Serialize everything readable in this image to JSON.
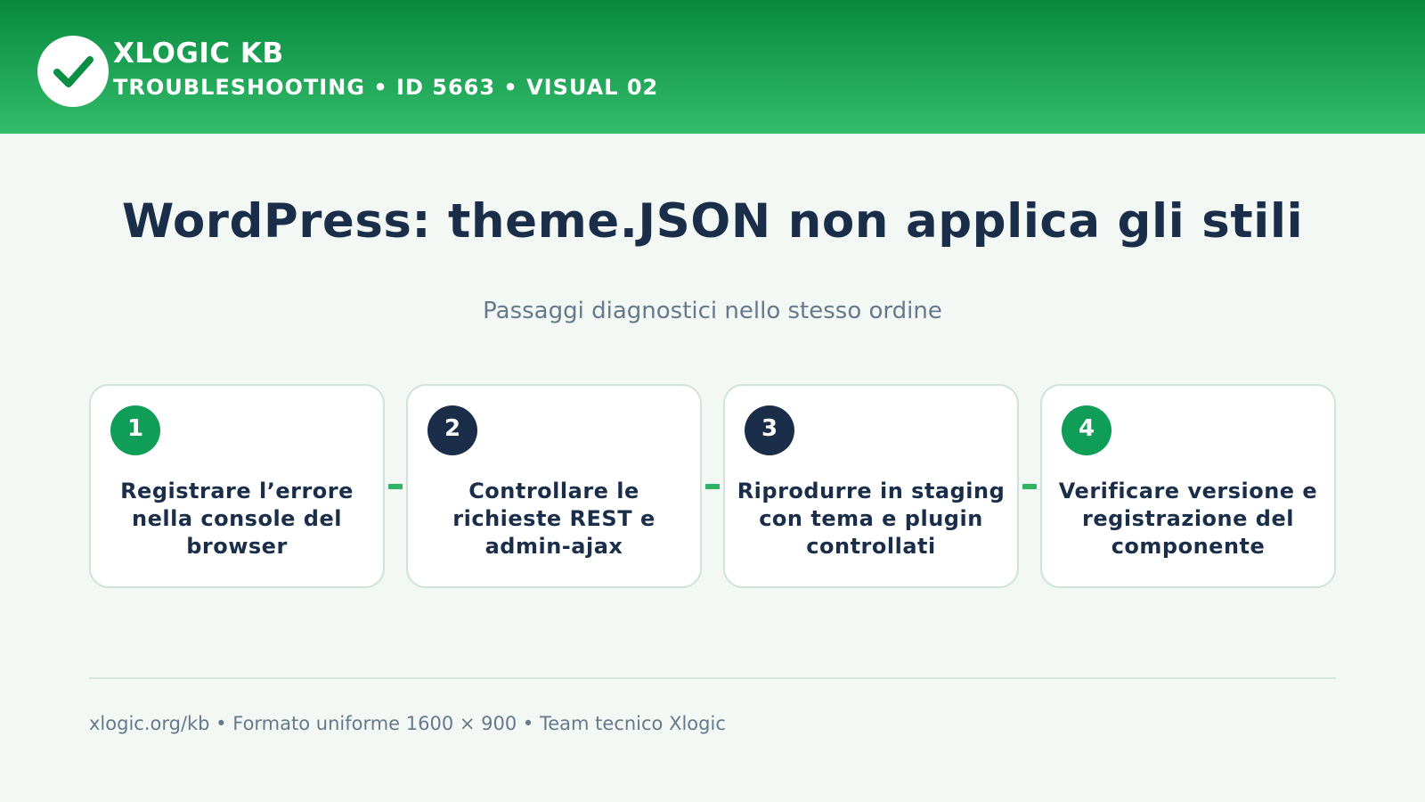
{
  "header": {
    "brand_name": "XLOGIC KB",
    "brand_sub": "TROUBLESHOOTING • ID 5663 • VISUAL 02",
    "logo_icon": "checkmark-icon"
  },
  "title": "WordPress: theme.JSON non applica gli stili",
  "subtitle": "Passaggi diagnostici nello stesso ordine",
  "steps": [
    {
      "number": "1",
      "text": "Registrare l’errore nella console del browser",
      "badge_color": "#0f9d58"
    },
    {
      "number": "2",
      "text": "Controllare le richieste REST e admin-ajax",
      "badge_color": "#1a2e4a"
    },
    {
      "number": "3",
      "text": "Riprodurre in staging con tema e plugin controllati",
      "badge_color": "#1a2e4a"
    },
    {
      "number": "4",
      "text": "Verificare versione e registrazione del componente",
      "badge_color": "#0f9d58"
    }
  ],
  "footer": "xlogic.org/kb • Formato uniforme 1600 × 900 • Team tecnico Xlogic",
  "colors": {
    "header_top": "#078a3e",
    "header_bottom": "#34bb6b",
    "connector": "#2fb465",
    "text_dark": "#1a2e4a",
    "text_muted": "#66798c"
  }
}
